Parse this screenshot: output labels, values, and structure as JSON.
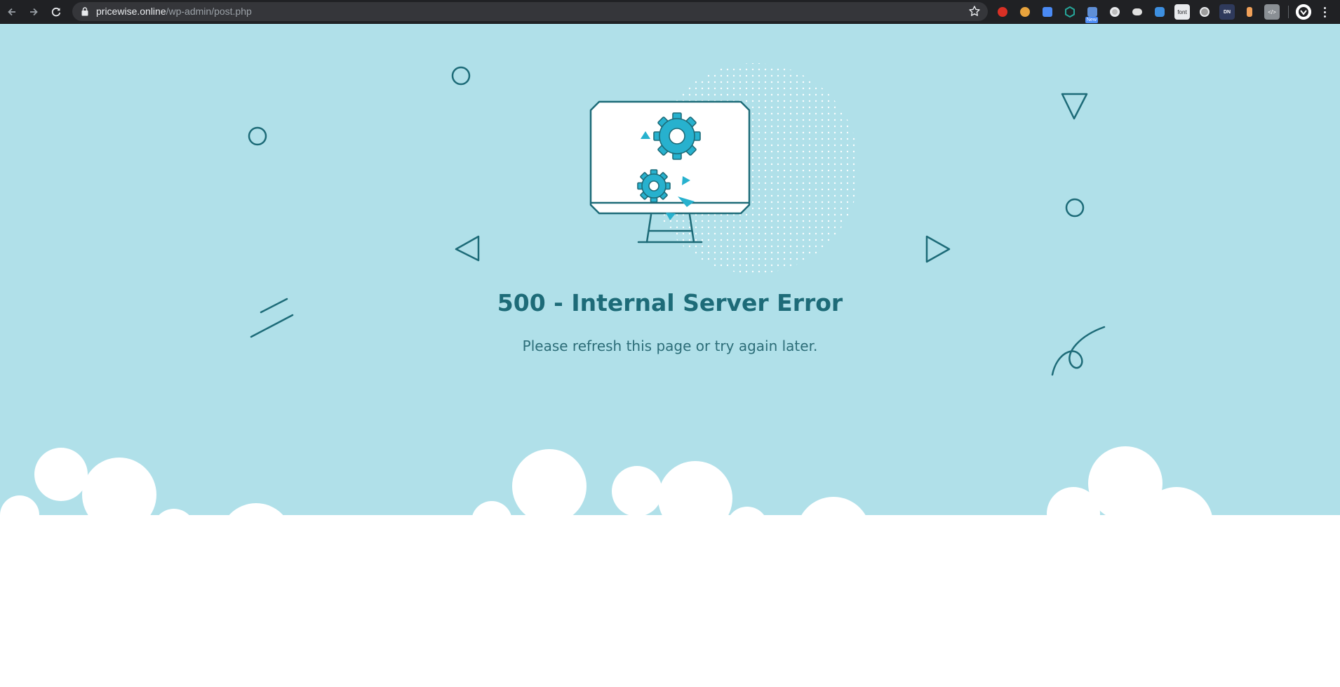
{
  "browser": {
    "url_domain": "pricewise.online",
    "url_path": "/wp-admin/post.php",
    "icons": {
      "back": "arrow-left-icon",
      "forward": "arrow-right-icon",
      "reload": "reload-icon",
      "lock": "lock-icon",
      "bookmark": "star-icon",
      "menu": "kebab-menu-icon"
    },
    "extensions": [
      {
        "name": "red-shield-extension",
        "color": "#d93025"
      },
      {
        "name": "cookie-extension",
        "color": "#e8a33d"
      },
      {
        "name": "pencil-extension",
        "color": "#4a8af4"
      },
      {
        "name": "teal-hexagon-extension",
        "color": "#26a69a"
      },
      {
        "name": "new-badge-extension",
        "color": "#5f8fd6",
        "badge": "New"
      },
      {
        "name": "grey-circle-extension",
        "color": "#bdbdbd"
      },
      {
        "name": "chat-bubbles-extension",
        "color": "#e0e0e0"
      },
      {
        "name": "cloud-extension",
        "color": "#3d8fe0"
      },
      {
        "name": "font-extension",
        "color": "#e8eaed",
        "label": "font"
      },
      {
        "name": "aperture-extension",
        "color": "#9e9e9e"
      },
      {
        "name": "dn-extension",
        "color": "#2f3a5c",
        "label": "DN"
      },
      {
        "name": "orange-jar-extension",
        "color": "#f0a058"
      },
      {
        "name": "code-extension",
        "color": "#8a8f94",
        "label": "</>"
      }
    ]
  },
  "error": {
    "title": "500 - Internal Server Error",
    "message": "Please refresh this page or try again later."
  },
  "colors": {
    "background": "#b0e0e9",
    "accent": "#27b1ce",
    "stroke": "#1d6b78",
    "title": "#1d6b78",
    "message": "#2c6d78",
    "clouds": "#ffffff"
  }
}
